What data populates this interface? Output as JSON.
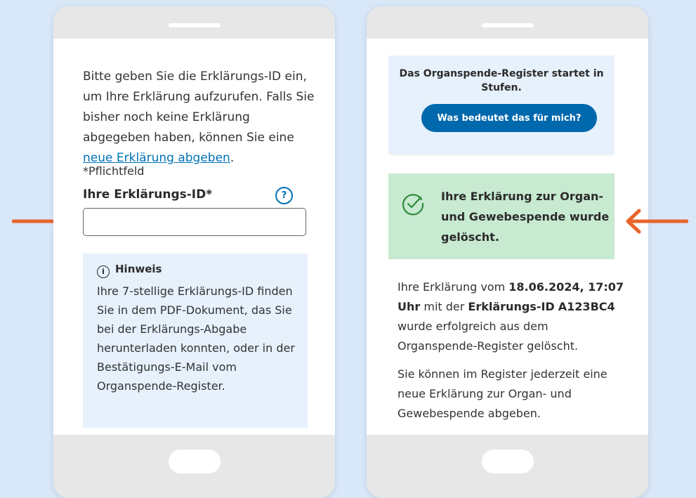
{
  "colors": {
    "background": "#d9e8f8",
    "accent_arrow": "#e8642c",
    "link": "#0071b8",
    "primary_button": "#0068ad",
    "hint_box": "#e6f1fc",
    "success_box": "#c7ead0",
    "success_icon": "#2e8b3a"
  },
  "left_screen": {
    "intro_text": "Bitte geben Sie die Erklärungs-ID ein, um Ihre Erklärung aufzurufen. Falls Sie bisher noch keine Erklärung abgegeben haben, können Sie eine ",
    "intro_link": "neue Erklärung abgeben",
    "intro_end": ".",
    "required_note": "*Pflichtfeld",
    "field_label": "Ihre Erklärungs-ID*",
    "help_icon": "question-mark-icon",
    "help_glyph": "?",
    "input_value": "",
    "hint_icon": "info-icon",
    "hint_icon_glyph": "i",
    "hint_title": "Hinweis",
    "hint_text": "Ihre 7-stellige Erklärungs-ID finden Sie in dem PDF-Dokument, das Sie bei der Erklärungs-Abgabe herunterladen konnten, oder in der Bestätigungs-E-Mail vom Organspende-Register."
  },
  "right_screen": {
    "banner_text": "Das Organspende-Register startet in Stufen.",
    "banner_button": "Was bedeutet das für mich?",
    "success_icon": "check-circle-icon",
    "success_text": "Ihre Erklärung zur Organ- und Gewebespende wurde gelöscht.",
    "result_prefix": "Ihre Erklärung vom ",
    "result_date": "18.06.2024, 17:07 Uhr",
    "result_mid": " mit der ",
    "result_id_label": "Erklärungs-ID",
    "result_id_value": "A123BC4",
    "result_suffix": " wurde erfolgreich aus dem Organspende-Register gelöscht.",
    "followup_text": "Sie können im Register jederzeit eine neue Erklärung zur Organ- und Gewebespende abgeben."
  },
  "arrows": {
    "left": "arrow-right-icon",
    "right": "arrow-left-icon"
  }
}
